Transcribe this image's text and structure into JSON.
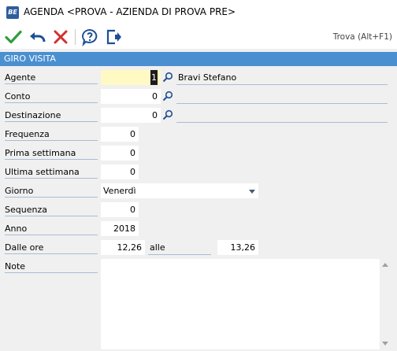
{
  "window": {
    "title": "AGENDA <PROVA - AZIENDA DI PROVA PRE>",
    "app_icon_text": "BE"
  },
  "toolbar": {
    "confirm_icon": "checkmark-icon",
    "undo_icon": "undo-arrow-icon",
    "cancel_icon": "x-cancel-icon",
    "help_icon": "help-question-icon",
    "exit_icon": "exit-door-icon",
    "find_label": "Trova (Alt+F1)"
  },
  "section": {
    "title": "GIRO VISITA"
  },
  "form": {
    "agente": {
      "label": "Agente",
      "value": "1",
      "description": "Bravi Stefano"
    },
    "conto": {
      "label": "Conto",
      "value": "0",
      "description": ""
    },
    "destinazione": {
      "label": "Destinazione",
      "value": "0",
      "description": ""
    },
    "frequenza": {
      "label": "Frequenza",
      "value": "0"
    },
    "prima_settimana": {
      "label": "Prima settimana",
      "value": "0"
    },
    "ultima_settimana": {
      "label": "Ultima settimana",
      "value": "0"
    },
    "giorno": {
      "label": "Giorno",
      "value": "Venerdì"
    },
    "sequenza": {
      "label": "Sequenza",
      "value": "0"
    },
    "anno": {
      "label": "Anno",
      "value": "2018"
    },
    "dalle_ore": {
      "label": "Dalle ore",
      "value": "12,26"
    },
    "alle": {
      "label": "alle",
      "value": "13,26"
    },
    "note": {
      "label": "Note",
      "value": ""
    }
  },
  "colors": {
    "header_blue": "#4a8fd0",
    "confirm_green": "#2e9e3e",
    "cancel_red": "#d32f2f",
    "accent_blue": "#1e4f96"
  }
}
